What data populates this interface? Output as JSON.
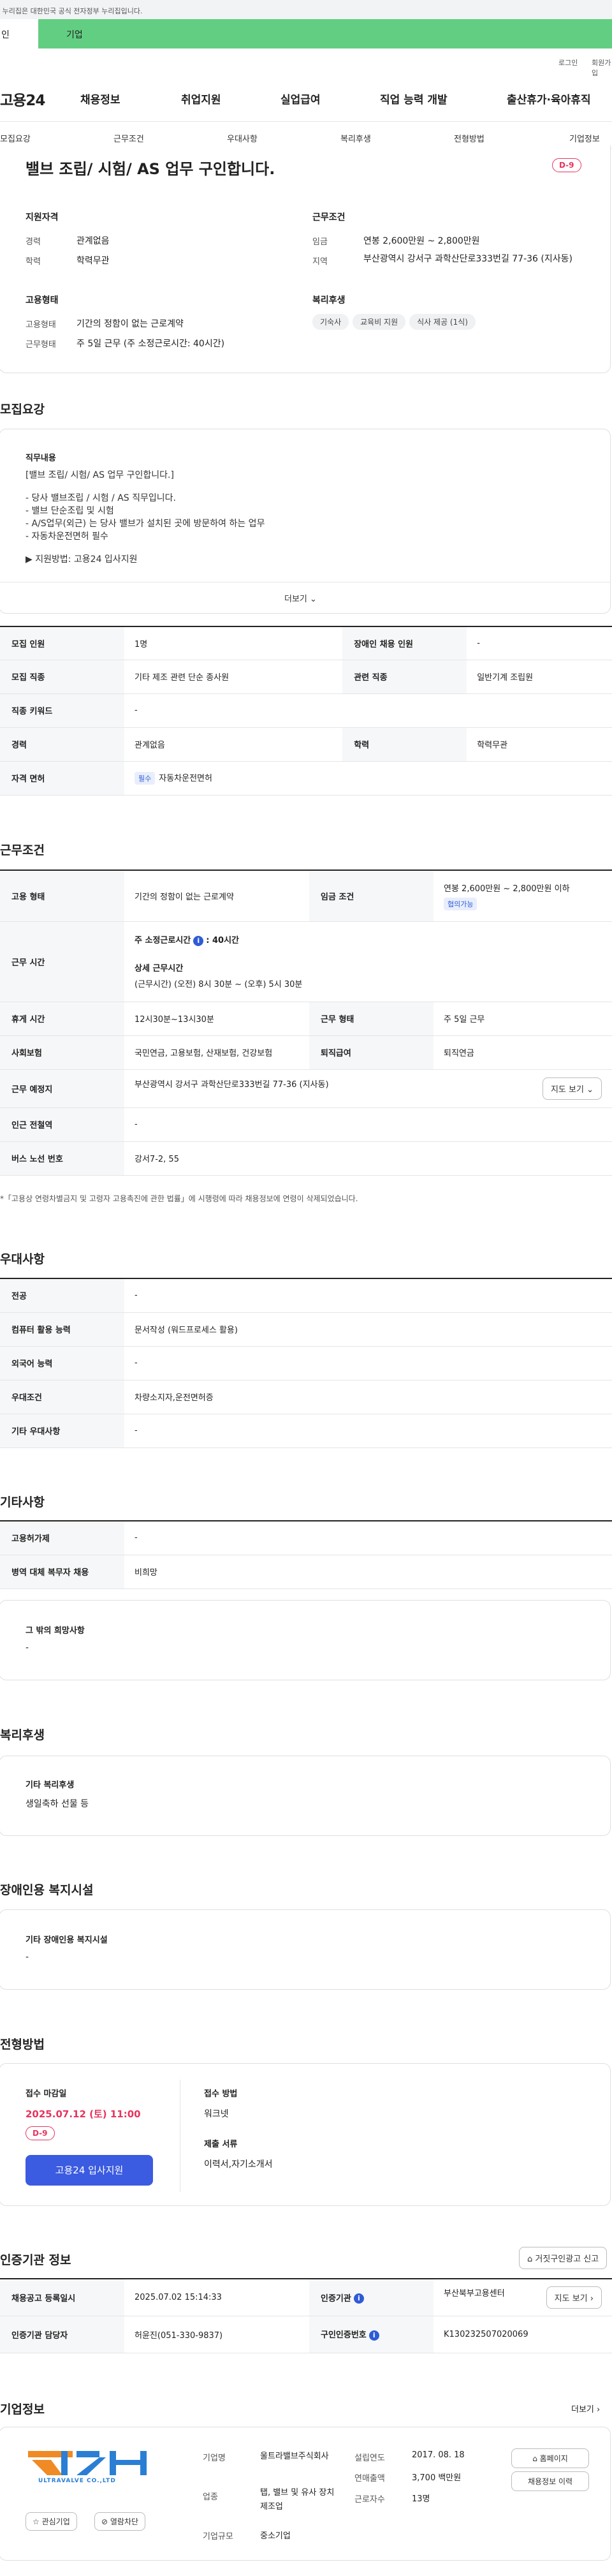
{
  "top": {
    "notice": "이 누리집은 대한민국 공식 전자정부 누리집입니다.",
    "tab_personal": "인",
    "tab_company": "기업",
    "login": "로그인",
    "signup": "회원가입"
  },
  "gnb": {
    "logo": "고용24",
    "items": [
      "채용정보",
      "취업지원",
      "실업급여",
      "직업 능력 개발",
      "출산휴가·육아휴직"
    ]
  },
  "anchors": [
    "모집요강",
    "근무조건",
    "우대사항",
    "복리후생",
    "전형방법",
    "기업정보"
  ],
  "job": {
    "title": "밸브 조립/ 시험/ AS 업무 구인합니다.",
    "dday": "D-9",
    "qual_title": "지원자격",
    "career_lbl": "경력",
    "career": "관계없음",
    "edu_lbl": "학력",
    "edu": "학력무관",
    "cond_title": "근무조건",
    "wage_lbl": "임금",
    "wage": "연봉 2,600만원 ~ 2,800만원",
    "region_lbl": "지역",
    "region": "부산광역시 강서구 과학산단로333번길 77-36 (지사동)",
    "emp_title": "고용형태",
    "emp_type_lbl": "고용형태",
    "emp_type": "기간의 정함이 없는 근로계약",
    "work_form_lbl": "근무형태",
    "work_form": "주 5일 근무 (주 소정근로시간: 40시간)",
    "welfare_title": "복리후생",
    "welfare_chips": [
      "기숙사",
      "교육비 지원",
      "식사 제공 (1식)"
    ]
  },
  "recruit": {
    "section": "모집요강",
    "duty_title": "직무내용",
    "desc": [
      "[밸브 조립/ 시험/ AS 업무 구인합니다.]",
      "",
      "- 당사 밸브조립 / 시험 / AS 직무입니다.",
      "- 밸브 단순조립 및 시험",
      "- A/S업무(외근) 는 당사 밸브가 설치된 곳에 방문하여 하는 업무",
      "- 자동차운전면허 필수",
      "",
      "▶ 지원방법: 고용24 입사지원"
    ],
    "more": "더보기",
    "r1": [
      "모집 인원",
      "1명",
      "장애인 채용 인원",
      "-"
    ],
    "r2": [
      "모집 직종",
      "기타 제조 관련 단순 종사원",
      "관련 직종",
      "일반기계 조립원"
    ],
    "r3": [
      "직종 키워드",
      "-"
    ],
    "r4": [
      "경력",
      "관계없음",
      "학력",
      "학력무관"
    ],
    "r5": [
      "자격 면허",
      "필수",
      "자동차운전면허"
    ]
  },
  "work": {
    "section": "근무조건",
    "employ_lbl": "고용 형태",
    "employ": "기간의 정함이 없는 근로계약",
    "wage_lbl": "임금 조건",
    "wage": "연봉 2,600만원 ~ 2,800만원 이하",
    "wage_tag": "협의가능",
    "time_lbl": "근무 시간",
    "weekly": "주 소정근로시간",
    "weekly_val": ": 40시간",
    "detail_title": "상세 근무시간",
    "detail": "(근무시간) (오전) 8시 30분 ~ (오후) 5시 30분",
    "rest_lbl": "휴게 시간",
    "rest": "12시30분~13시30분",
    "form_lbl": "근무 형태",
    "form": "주 5일 근무",
    "ins_lbl": "사회보험",
    "ins": "국민연금, 고용보험, 산재보험, 건강보험",
    "sev_lbl": "퇴직급여",
    "sev": "퇴직연금",
    "place_lbl": "근무 예정지",
    "place": "부산광역시 강서구 과학산단로333번길 77-36 (지사동)",
    "map_btn": "지도 보기",
    "subway_lbl": "인근 전철역",
    "subway": "-",
    "bus_lbl": "버스 노선 번호",
    "bus": "강서7-2, 55",
    "note": "*「고용상 연령차별금지 및 고령자 고용촉진에 관한 법률」에 시행령에 따라 채용정보에 연령이 삭제되었습니다."
  },
  "pref": {
    "section": "우대사항",
    "rows": [
      [
        "전공",
        "-"
      ],
      [
        "컴퓨터 활용 능력",
        "문서작성 (워드프로세스 활용)"
      ],
      [
        "외국어 능력",
        "-"
      ],
      [
        "우대조건",
        "차량소지자,운전면허증"
      ],
      [
        "기타 우대사항",
        "-"
      ]
    ]
  },
  "etc": {
    "section": "기타사항",
    "rows": [
      [
        "고용허가제",
        "-"
      ],
      [
        "병역 대체 복무자 채용",
        "비희망"
      ]
    ],
    "other_title": "그 밖의 희망사항",
    "other": "-"
  },
  "welfare": {
    "section": "복리후생",
    "title": "기타 복리후생",
    "text": "생일축하 선물 등"
  },
  "disab": {
    "section": "장애인용 복지시설",
    "title": "기타 장애인용 복지시설",
    "text": "-"
  },
  "select": {
    "section": "전형방법",
    "deadline_lbl": "접수 마감일",
    "deadline": "2025.07.12 (토) 11:00",
    "dday": "D-9",
    "apply_btn": "고용24 입사지원",
    "method_lbl": "접수 방법",
    "method": "워크넷",
    "docs_lbl": "제출 서류",
    "docs": "이력서,자기소개서"
  },
  "agency": {
    "section": "인증기관 정보",
    "report_btn": "거짓구인광고 신고",
    "reg_lbl": "채용공고 등록일시",
    "reg": "2025.07.02 15:14:33",
    "org_lbl": "인증기관",
    "org": "부산북부고용센터",
    "map_btn": "지도 보기",
    "mgr_lbl": "인증기관 담당자",
    "mgr": "허윤진(051-330-9837)",
    "no_lbl": "구인인증번호",
    "no": "K130232507020069"
  },
  "company": {
    "section": "기업정보",
    "more": "더보기",
    "logo_text": "ULTRAVALVE CO.,LTD",
    "fav_btn": "관심기업",
    "block_btn": "열람차단",
    "name_lbl": "기업명",
    "name": "울트라밸브주식회사",
    "found_lbl": "설립연도",
    "found": "2017. 08. 18",
    "ind_lbl": "업종",
    "ind": "탭, 밸브 및 유사 장치 제조업",
    "sales_lbl": "연매출액",
    "sales": "3,700 백만원",
    "emp_lbl": "근로자수",
    "emp": "13명",
    "size_lbl": "기업규모",
    "size": "중소기업",
    "home_btn": "홈페이지",
    "jobs_btn": "채용정보 이력"
  }
}
